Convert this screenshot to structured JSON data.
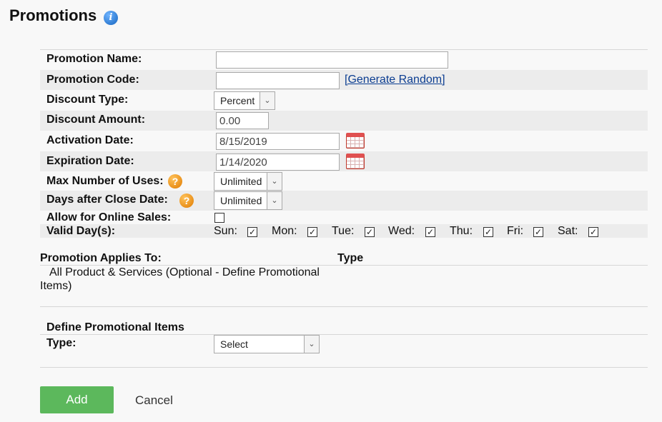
{
  "page": {
    "title": "Promotions",
    "info_icon": "info-icon"
  },
  "form": {
    "promotion_name": {
      "label": "Promotion Name:",
      "value": ""
    },
    "promotion_code": {
      "label": "Promotion Code:",
      "value": "",
      "generate_link": "[Generate Random]"
    },
    "discount_type": {
      "label": "Discount Type:",
      "selected": "Percent"
    },
    "discount_amount": {
      "label": "Discount Amount:",
      "value": "0.00"
    },
    "activation_date": {
      "label": "Activation Date:",
      "value": "8/15/2019"
    },
    "expiration_date": {
      "label": "Expiration Date:",
      "value": "1/14/2020"
    },
    "max_uses": {
      "label": "Max Number of Uses:",
      "selected": "Unlimited"
    },
    "days_after_close": {
      "label": "Days after Close Date:",
      "selected": "Unlimited"
    },
    "allow_online": {
      "label": "Allow for Online Sales:",
      "checked": false
    },
    "valid_days": {
      "label": "Valid Day(s):",
      "days": [
        {
          "label": "Sun:",
          "checked": true
        },
        {
          "label": "Mon:",
          "checked": true
        },
        {
          "label": "Tue:",
          "checked": true
        },
        {
          "label": "Wed:",
          "checked": true
        },
        {
          "label": "Thu:",
          "checked": true
        },
        {
          "label": "Fri:",
          "checked": true
        },
        {
          "label": "Sat:",
          "checked": true
        }
      ]
    }
  },
  "applies": {
    "header": "Promotion Applies To:",
    "type_header": "Type",
    "line1": "All Product & Services (Optional - Define Promotional",
    "line2": "Items)"
  },
  "define": {
    "header": "Define Promotional Items",
    "type_label": "Type:",
    "type_selected": "Select"
  },
  "actions": {
    "add": "Add",
    "cancel": "Cancel"
  },
  "colors": {
    "add_button": "#5cb85c",
    "link": "#0b3d91",
    "band": "#ececec"
  }
}
